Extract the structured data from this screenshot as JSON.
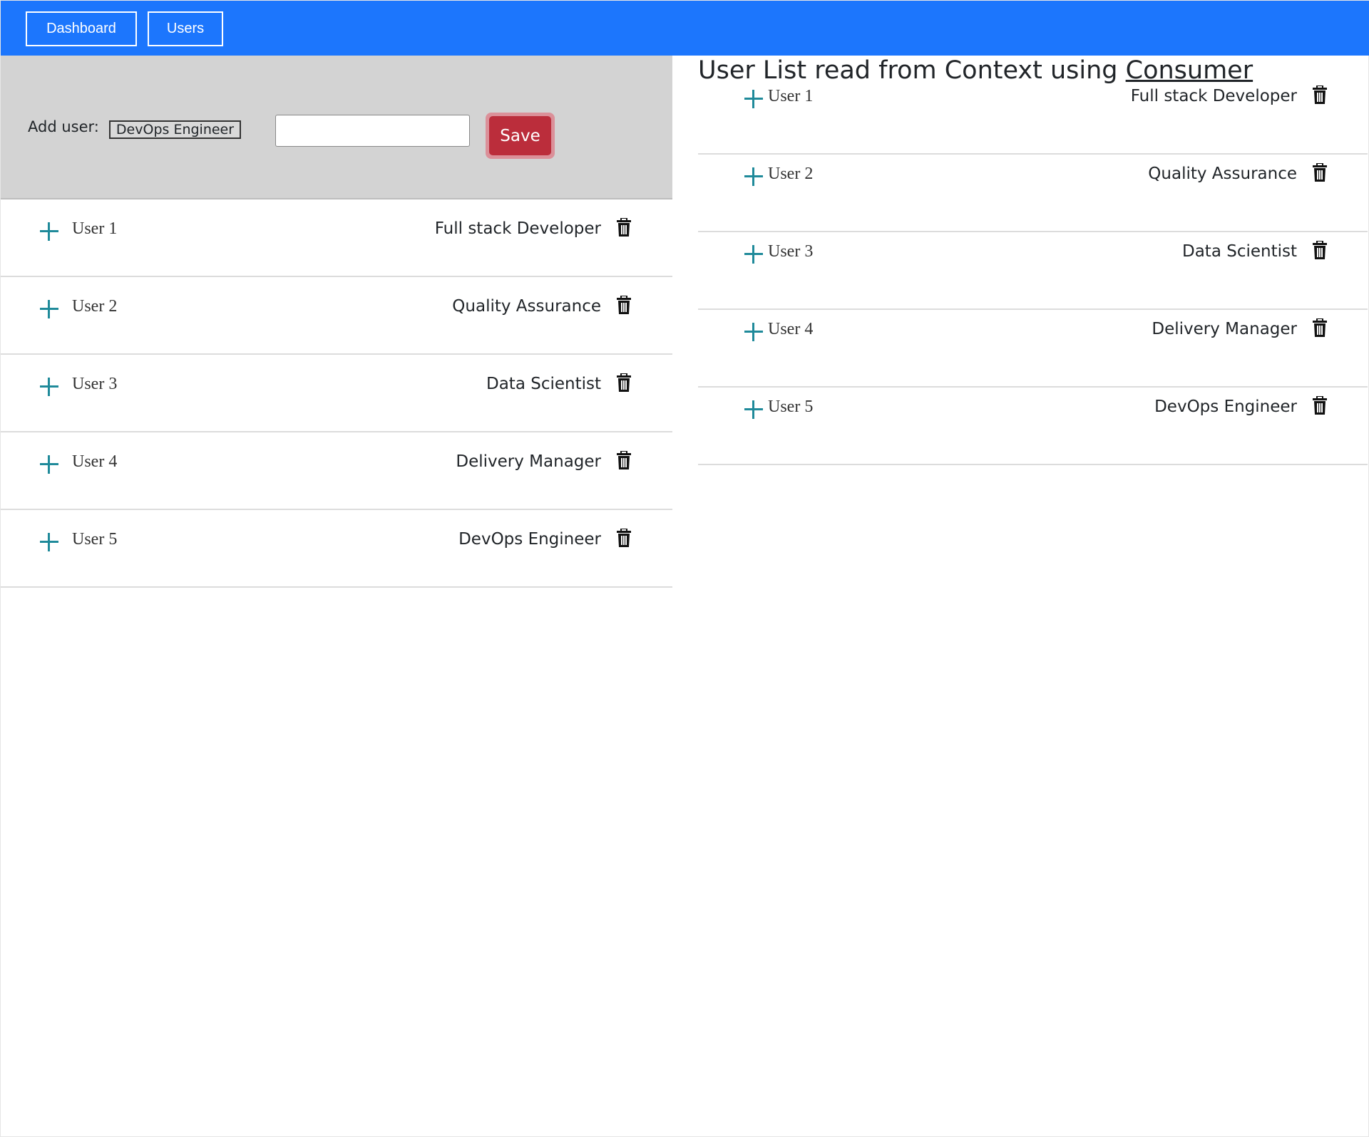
{
  "nav": {
    "items": [
      {
        "label": "Dashboard"
      },
      {
        "label": "Users"
      }
    ],
    "color": "#1c76fd"
  },
  "form": {
    "label": "Add user:",
    "select_value": "DevOps Engineer",
    "input_value": "",
    "save_label": "Save",
    "save_color": "#bb2d3b"
  },
  "users": [
    {
      "name": "User 1",
      "role": "Full stack Developer"
    },
    {
      "name": "User 2",
      "role": "Quality Assurance"
    },
    {
      "name": "User 3",
      "role": "Data Scientist"
    },
    {
      "name": "User 4",
      "role": "Delivery Manager"
    },
    {
      "name": "User 5",
      "role": "DevOps Engineer"
    }
  ],
  "consumer": {
    "heading": "User List read from Context using ",
    "heading_link": "Consumer"
  },
  "icons": {
    "add": "plus-icon",
    "delete": "trash-icon"
  }
}
